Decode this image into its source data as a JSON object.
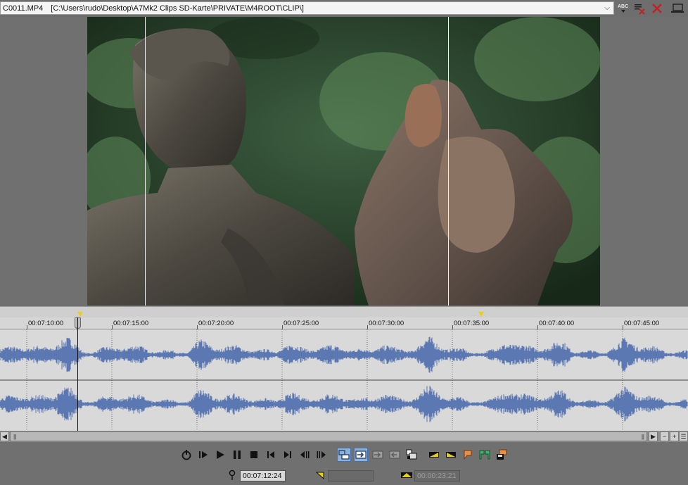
{
  "header": {
    "file_name": "C0011.MP4",
    "file_path": "[C:\\Users\\rudo\\Desktop\\A7Mk2 Clips SD-Karte\\PRIVATE\\M4ROOT\\CLIP\\]",
    "abc_label": "ABC",
    "icons": [
      "chevron-down-icon",
      "spellcheck-icon",
      "clear-list-icon",
      "close-icon",
      "monitor-icon"
    ]
  },
  "ruler": {
    "ticks": [
      "00:07:10:00",
      "00:07:15:00",
      "00:07:20:00",
      "00:07:25:00",
      "00:07:30:00",
      "00:07:35:00",
      "00:07:40:00",
      "00:07:45:00"
    ]
  },
  "colors": {
    "waveform": "#5b78b3",
    "marker": "#e8cf1a",
    "active_button": "#8fb0d4"
  },
  "transport": {
    "buttons": [
      "loop-icon",
      "play-from-start-icon",
      "play-icon",
      "pause-icon",
      "stop-icon",
      "go-to-start-icon",
      "go-to-end-icon",
      "previous-frame-icon",
      "next-frame-icon",
      "create-region-icon",
      "insert-icon",
      "overwrite-icon",
      "trim-icon",
      "subclip-icon",
      "mark-in-icon",
      "mark-out-icon",
      "add-marker-icon",
      "add-region-icon",
      "save-icon"
    ],
    "cursor_time": "00:07:12:24",
    "in_time": "",
    "length_time": "00:00:23:21"
  }
}
